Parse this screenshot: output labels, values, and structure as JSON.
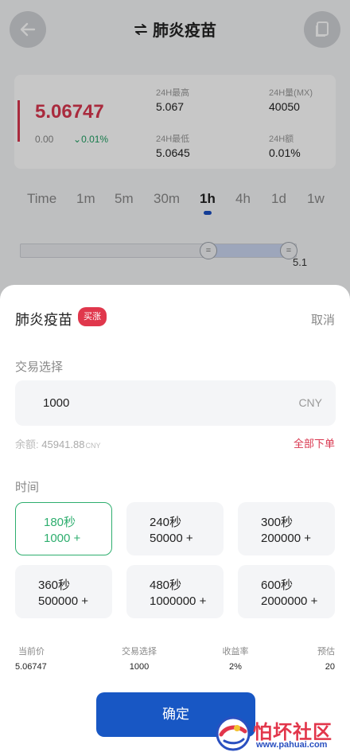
{
  "header": {
    "title": "肺炎疫苗",
    "swap_icon": "swap-arrows-icon",
    "back_icon": "back-arrow-icon",
    "doc_icon": "document-icon"
  },
  "price": {
    "current": "5.06747",
    "change": "0.00",
    "change_pct": "0.01%"
  },
  "stats": {
    "high_label": "24H最高",
    "high": "5.067",
    "volume_label": "24H量(MX)",
    "volume": "40050",
    "low_label": "24H最低",
    "low": "5.0645",
    "amount_label": "24H额",
    "amount": "0.01%"
  },
  "timeframes": [
    "Time",
    "1m",
    "5m",
    "30m",
    "1h",
    "4h",
    "1d",
    "1w"
  ],
  "active_timeframe": "1h",
  "slider": {
    "value": "5.1"
  },
  "sheet": {
    "title": "肺炎疫苗",
    "badge": "买涨",
    "cancel": "取消",
    "trade_label": "交易选择",
    "amount": "1000",
    "unit": "CNY",
    "balance_label": "余额:",
    "balance": "45941.88",
    "balance_unit": "CNY",
    "all_order": "全部下单",
    "time_label": "时间",
    "options": [
      {
        "time": "180秒",
        "amount": "1000 +"
      },
      {
        "time": "240秒",
        "amount": "50000 +"
      },
      {
        "time": "300秒",
        "amount": "200000 +"
      },
      {
        "time": "360秒",
        "amount": "500000 +"
      },
      {
        "time": "480秒",
        "amount": "1000000 +"
      },
      {
        "time": "600秒",
        "amount": "2000000 +"
      }
    ],
    "info": [
      {
        "label": "当前价",
        "value": "5.06747"
      },
      {
        "label": "交易选择",
        "value": "1000"
      },
      {
        "label": "收益率",
        "value": "2%"
      },
      {
        "label": "预估",
        "value": "20"
      }
    ],
    "confirm": "确定"
  },
  "watermark": {
    "title": "怕坏社区",
    "url": "www.pahuai.com"
  },
  "colors": {
    "red": "#d9374f",
    "green": "#2eae6e",
    "blue": "#1857c4"
  }
}
